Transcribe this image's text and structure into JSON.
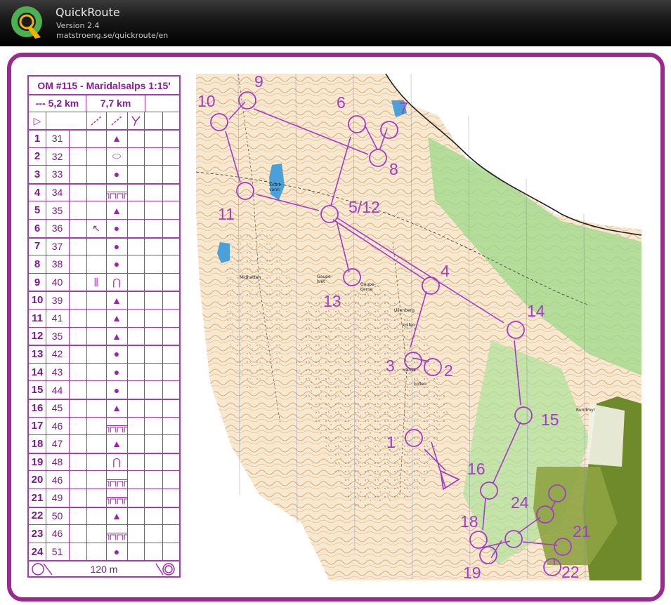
{
  "app": {
    "title": "QuickRoute",
    "version": "Version 2.4",
    "url": "matstroeng.se/quickroute/en"
  },
  "description": {
    "title": "OM #115 - Maridalsalps 1:15'",
    "climb": "--- 5,2 km",
    "length": "7,7 km",
    "start_symbol": "▷",
    "controls": [
      {
        "num": "1",
        "code": "31",
        "sym": "▲",
        "dir": ""
      },
      {
        "num": "2",
        "code": "32",
        "sym": "⬭",
        "dir": ""
      },
      {
        "num": "3",
        "code": "33",
        "sym": "●",
        "dir": ""
      },
      {
        "num": "4",
        "code": "34",
        "sym": "╦╦╦",
        "dir": ""
      },
      {
        "num": "5",
        "code": "35",
        "sym": "▲",
        "dir": ""
      },
      {
        "num": "6",
        "code": "36",
        "sym": "●",
        "dir": "↖"
      },
      {
        "num": "7",
        "code": "37",
        "sym": "●",
        "dir": ""
      },
      {
        "num": "8",
        "code": "38",
        "sym": "●",
        "dir": ""
      },
      {
        "num": "9",
        "code": "40",
        "sym": "⋂",
        "dir": "⫼"
      },
      {
        "num": "10",
        "code": "39",
        "sym": "▲",
        "dir": ""
      },
      {
        "num": "11",
        "code": "41",
        "sym": "▲",
        "dir": ""
      },
      {
        "num": "12",
        "code": "35",
        "sym": "▲",
        "dir": ""
      },
      {
        "num": "13",
        "code": "42",
        "sym": "●",
        "dir": ""
      },
      {
        "num": "14",
        "code": "43",
        "sym": "●",
        "dir": ""
      },
      {
        "num": "15",
        "code": "44",
        "sym": "●",
        "dir": ""
      },
      {
        "num": "16",
        "code": "45",
        "sym": "▲",
        "dir": ""
      },
      {
        "num": "17",
        "code": "46",
        "sym": "╦╦╦",
        "dir": ""
      },
      {
        "num": "18",
        "code": "47",
        "sym": "▲",
        "dir": ""
      },
      {
        "num": "19",
        "code": "48",
        "sym": "⋂",
        "dir": ""
      },
      {
        "num": "20",
        "code": "46",
        "sym": "╦╦╦",
        "dir": ""
      },
      {
        "num": "21",
        "code": "49",
        "sym": "╦╦╦",
        "dir": ""
      },
      {
        "num": "22",
        "code": "50",
        "sym": "▲",
        "dir": ""
      },
      {
        "num": "23",
        "code": "46",
        "sym": "╦╦╦",
        "dir": ""
      },
      {
        "num": "24",
        "code": "51",
        "sym": "●",
        "dir": ""
      }
    ],
    "finish_distance": "120 m"
  },
  "map": {
    "labels": {
      "c1": "1",
      "c2": "2",
      "c3": "3",
      "c4": "4",
      "c512": "5/12",
      "c6": "6",
      "c7": "7",
      "c8": "8",
      "c9": "9",
      "c10": "10",
      "c11": "11",
      "c13": "13",
      "c14": "14",
      "c15": "15",
      "c16": "16",
      "c18": "18",
      "c19": "19",
      "c21": "21",
      "c22": "22",
      "c24": "24"
    },
    "place_names": {
      "svartvann": "Svart-vann",
      "midhatten": "Midhatten",
      "gaupehiet": "Gaupe-hiet",
      "gaupetjern": "Gaupe-tjerne",
      "ullenberg": "Ullenberg",
      "kollen": "kollen",
      "hansa": "Hansa",
      "kollen2": "kollen",
      "rundmyr": "Rundmyr"
    }
  }
}
